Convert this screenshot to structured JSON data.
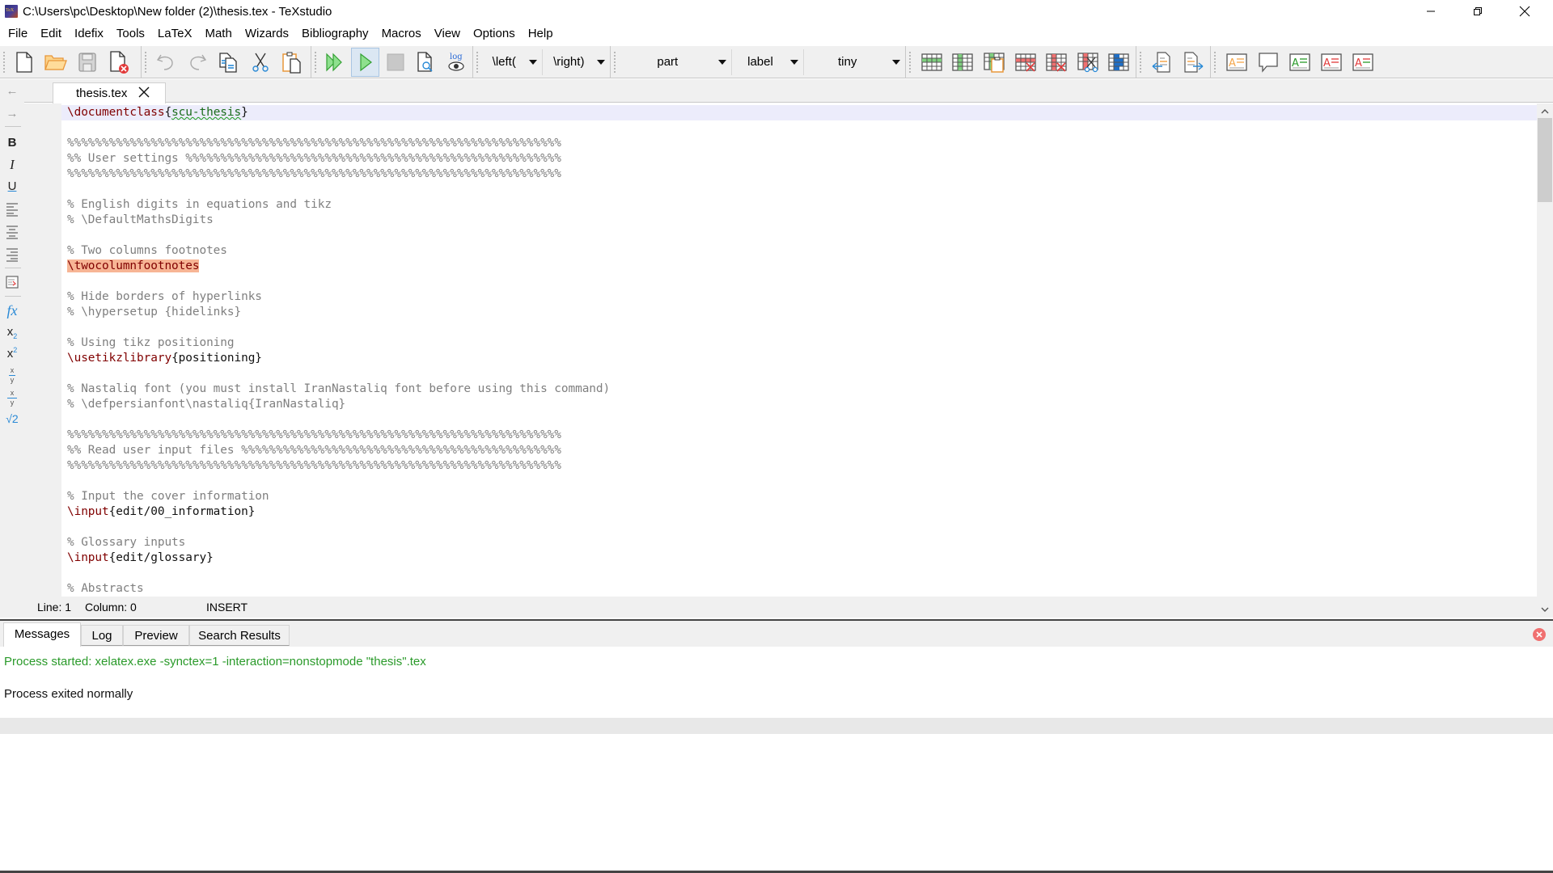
{
  "window": {
    "title": "C:\\Users\\pc\\Desktop\\New folder (2)\\thesis.tex - TeXstudio",
    "controls": [
      "minimize",
      "maximize",
      "close"
    ]
  },
  "menu": [
    "File",
    "Edit",
    "Idefix",
    "Tools",
    "LaTeX",
    "Math",
    "Wizards",
    "Bibliography",
    "Macros",
    "View",
    "Options",
    "Help"
  ],
  "toolbar": {
    "file_icons": [
      "new-file-icon",
      "open-folder-icon",
      "save-icon",
      "close-file-icon"
    ],
    "edit_icons": [
      "undo-icon",
      "redo-icon",
      "copy-icon",
      "cut-icon",
      "paste-icon"
    ],
    "build_icons": [
      "build-and-view-icon",
      "compile-icon",
      "stop-icon",
      "view-pdf-icon",
      "view-log-icon"
    ],
    "left_delim": "\\left(",
    "right_delim": "\\right)",
    "section": "part",
    "ref": "label",
    "size": "tiny",
    "table_icons": [
      "add-row-icon",
      "add-column-icon",
      "paste-column-icon",
      "remove-row-icon",
      "remove-column-icon",
      "cut-column-icon",
      "align-columns-icon"
    ],
    "nav_icons": [
      "previous-mark-icon",
      "next-mark-icon"
    ],
    "review_icons": [
      "review-insert-icon",
      "review-comment-icon",
      "review-add-icon",
      "review-delete-icon",
      "review-replace-icon"
    ]
  },
  "leftbar": {
    "back": "←",
    "forward": "→",
    "bold": "B",
    "italic": "I",
    "underline": "U",
    "fx": "fx",
    "subscript": "x",
    "subscript_sub": "2",
    "superscript": "x",
    "superscript_sup": "2",
    "frac_num": "x",
    "frac_den": "y",
    "dfrac_num": "x",
    "dfrac_den": "y",
    "sqrt": "√2"
  },
  "tab": {
    "filename": "thesis.tex"
  },
  "editor": {
    "lines": [
      [
        {
          "t": "cmd",
          "v": "\\documentclass"
        },
        {
          "t": "brace",
          "v": "{"
        },
        {
          "t": "spell",
          "v": "scu-thesis"
        },
        {
          "t": "brace",
          "v": "}"
        }
      ],
      [],
      [
        {
          "t": "comment",
          "v": "%%%%%%%%%%%%%%%%%%%%%%%%%%%%%%%%%%%%%%%%%%%%%%%%%%%%%%%%%%%%%%%%%%%%%%%"
        }
      ],
      [
        {
          "t": "comment",
          "v": "%% User settings %%%%%%%%%%%%%%%%%%%%%%%%%%%%%%%%%%%%%%%%%%%%%%%%%%%%%%"
        }
      ],
      [
        {
          "t": "comment",
          "v": "%%%%%%%%%%%%%%%%%%%%%%%%%%%%%%%%%%%%%%%%%%%%%%%%%%%%%%%%%%%%%%%%%%%%%%%"
        }
      ],
      [],
      [
        {
          "t": "comment",
          "v": "% English digits in equations and tikz"
        }
      ],
      [
        {
          "t": "comment",
          "v": "% \\DefaultMathsDigits"
        }
      ],
      [],
      [
        {
          "t": "comment",
          "v": "% Two columns footnotes"
        }
      ],
      [
        {
          "t": "hl",
          "v": "\\twocolumnfootnotes"
        }
      ],
      [],
      [
        {
          "t": "comment",
          "v": "% Hide borders of hyperlinks"
        }
      ],
      [
        {
          "t": "comment",
          "v": "% \\hypersetup {hidelinks}"
        }
      ],
      [],
      [
        {
          "t": "comment",
          "v": "% Using tikz positioning"
        }
      ],
      [
        {
          "t": "cmd",
          "v": "\\usetikzlibrary"
        },
        {
          "t": "arg",
          "v": "{positioning}"
        }
      ],
      [],
      [
        {
          "t": "comment",
          "v": "% Nastaliq font (you must install IranNastaliq font before using this command)"
        }
      ],
      [
        {
          "t": "comment",
          "v": "% \\defpersianfont\\nastaliq{IranNastaliq}"
        }
      ],
      [],
      [
        {
          "t": "comment",
          "v": "%%%%%%%%%%%%%%%%%%%%%%%%%%%%%%%%%%%%%%%%%%%%%%%%%%%%%%%%%%%%%%%%%%%%%%%"
        }
      ],
      [
        {
          "t": "comment",
          "v": "%% Read user input files %%%%%%%%%%%%%%%%%%%%%%%%%%%%%%%%%%%%%%%%%%%%%%"
        }
      ],
      [
        {
          "t": "comment",
          "v": "%%%%%%%%%%%%%%%%%%%%%%%%%%%%%%%%%%%%%%%%%%%%%%%%%%%%%%%%%%%%%%%%%%%%%%%"
        }
      ],
      [],
      [
        {
          "t": "comment",
          "v": "% Input the cover information"
        }
      ],
      [
        {
          "t": "cmd",
          "v": "\\input"
        },
        {
          "t": "arg",
          "v": "{edit/00_information}"
        }
      ],
      [],
      [
        {
          "t": "comment",
          "v": "% Glossary inputs"
        }
      ],
      [
        {
          "t": "cmd",
          "v": "\\input"
        },
        {
          "t": "arg",
          "v": "{edit/glossary}"
        }
      ],
      [],
      [
        {
          "t": "comment",
          "v": "% Abstracts"
        }
      ]
    ],
    "current_line": 1
  },
  "status": {
    "line": "Line: 1",
    "column": "Column: 0",
    "mode": "INSERT"
  },
  "panel": {
    "tabs": [
      "Messages",
      "Log",
      "Preview",
      "Search Results"
    ],
    "active_tab": 0,
    "messages": [
      {
        "text": "Process started: xelatex.exe -synctex=1 -interaction=nonstopmode \"thesis\".tex",
        "color": "#2a9a2a"
      },
      {
        "text": "Process exited normally",
        "color": "#111111"
      }
    ]
  },
  "colors": {
    "comment": "#7f7f7f",
    "command": "#800000",
    "highlight": "#f7b595",
    "current_line": "#ececfb",
    "success": "#2a9a2a"
  }
}
